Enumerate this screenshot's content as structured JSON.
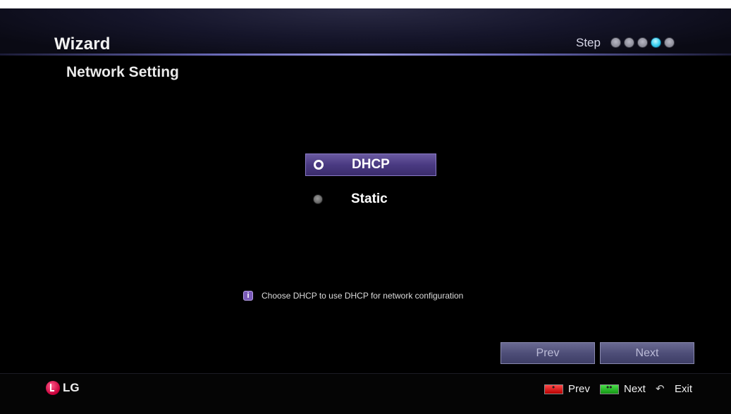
{
  "header": {
    "title": "Wizard",
    "step_label": "Step",
    "steps": [
      {
        "state": "done"
      },
      {
        "state": "done"
      },
      {
        "state": "done"
      },
      {
        "state": "current"
      },
      {
        "state": "pending"
      }
    ],
    "current_step": 4,
    "total_steps": 5
  },
  "page": {
    "title": "Network Setting"
  },
  "options": {
    "dhcp_label": "DHCP",
    "static_label": "Static",
    "selected": "DHCP"
  },
  "info": {
    "icon": "info-icon",
    "text": "Choose DHCP to use DHCP for network configuration"
  },
  "buttons": {
    "prev_label": "Prev",
    "next_label": "Next"
  },
  "footer": {
    "brand": "LG",
    "legend": {
      "red_label": "Prev",
      "green_label": "Next",
      "back_label": "Exit"
    }
  },
  "colors": {
    "selection": "#4a3a82",
    "active_step": "#3ad0f0",
    "button": "#4e4e78"
  }
}
